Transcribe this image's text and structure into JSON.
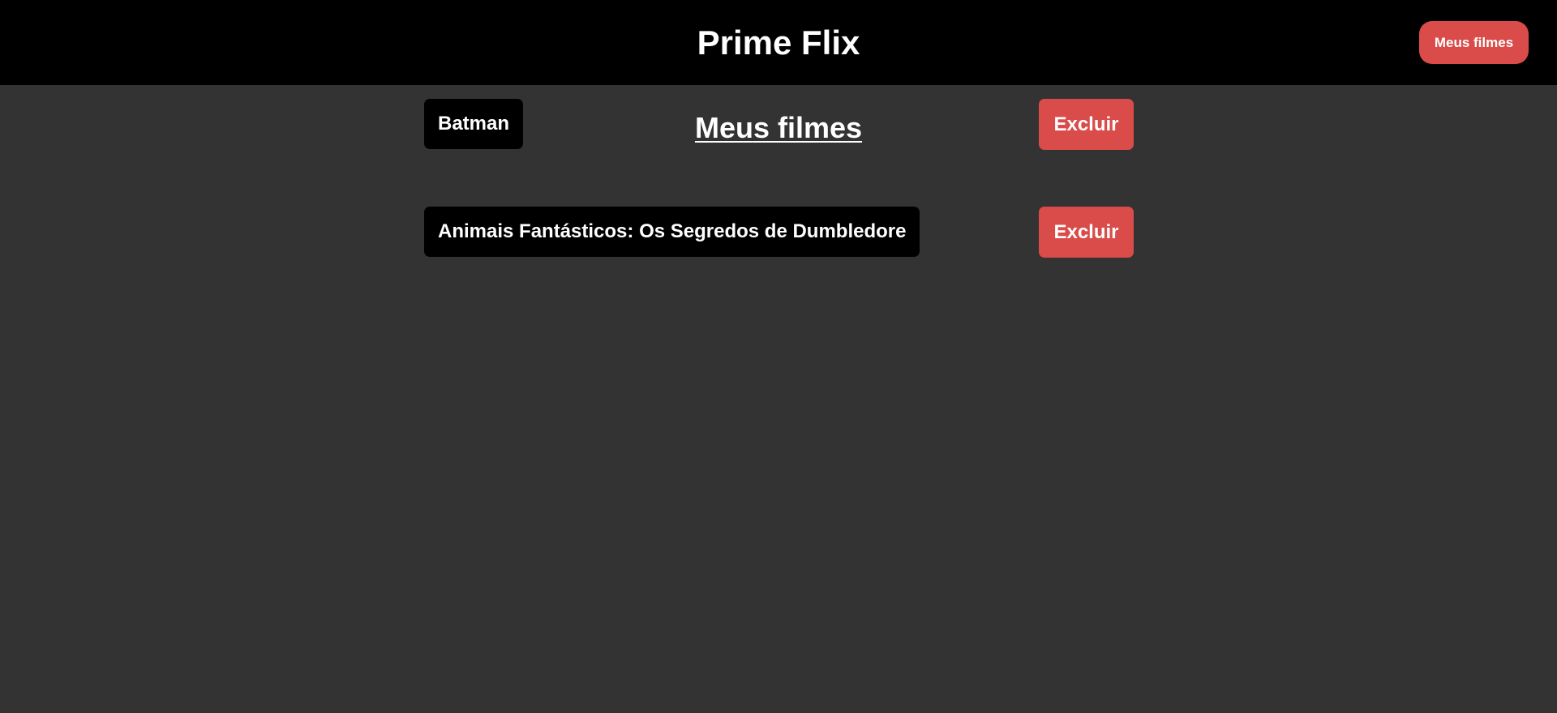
{
  "header": {
    "brand": "Prime Flix",
    "my_movies_label": "Meus filmes"
  },
  "main": {
    "title": "Meus filmes",
    "movies": [
      {
        "title": "Batman",
        "delete_label": "Excluir"
      },
      {
        "title": "Animais Fantásticos: Os Segredos de Dumbledore",
        "delete_label": "Excluir"
      }
    ]
  },
  "colors": {
    "header_background": "#000000",
    "page_background": "#333333",
    "accent": "#d94c4a",
    "text": "#ffffff"
  }
}
